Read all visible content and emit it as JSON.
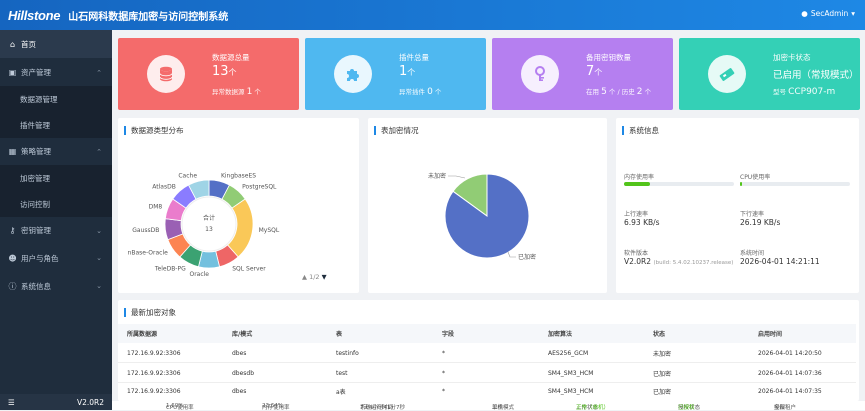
{
  "header": {
    "logo": "Hillstone",
    "title": "山石网科数据库加密与访问控制系统",
    "user": "SecAdmin",
    "user_icon": "user-icon",
    "color": "#1e88e5"
  },
  "sidebar": {
    "items": [
      {
        "label": "首页",
        "icon": "home-icon",
        "level": 0,
        "active": true
      },
      {
        "label": "资产管理",
        "icon": "asset-icon",
        "level": 0,
        "expanded": true
      },
      {
        "label": "数据源管理",
        "level": 1
      },
      {
        "label": "插件管理",
        "level": 1
      },
      {
        "label": "策略管理",
        "icon": "policy-icon",
        "level": 0,
        "expanded": true
      },
      {
        "label": "加密管理",
        "level": 1
      },
      {
        "label": "访问控制",
        "level": 1
      },
      {
        "label": "密钥管理",
        "icon": "key-icon",
        "level": 0
      },
      {
        "label": "用户与角色",
        "icon": "users-icon",
        "level": 0
      },
      {
        "label": "系统信息",
        "icon": "info-icon",
        "level": 0
      }
    ],
    "version": "V2.0R2"
  },
  "cards": [
    {
      "title": "数据源总量",
      "value": "13",
      "unit": "个",
      "sub_label": "异常数据源",
      "sub_value": "1",
      "sub_unit": "个",
      "color": "#f46b6b",
      "icon": "database-icon"
    },
    {
      "title": "插件总量",
      "value": "1",
      "unit": "个",
      "sub_label": "异常插件",
      "sub_value": "0",
      "sub_unit": "个",
      "color": "#4fb8f0",
      "icon": "puzzle-icon"
    },
    {
      "title": "备用密钥数量",
      "value": "7",
      "unit": "个",
      "sub_label": "在用",
      "sub_value": "5",
      "sub_unit": "个",
      "sub_label2": "历史",
      "sub_value2": "2",
      "sub_unit2": "个",
      "color": "#b57ff0",
      "icon": "key-lock-icon"
    },
    {
      "title": "加密卡状态",
      "value": "已启用（常规模式）",
      "sub_label": "型号",
      "sub_value": "CCP907-m",
      "color": "#34d0b6",
      "icon": "card-icon"
    }
  ],
  "datasource_dist": {
    "title": "数据源类型分布",
    "center_label": "合计",
    "center_value": "13",
    "page": "1/2",
    "labels_on_ring": [
      "KingbaseES",
      "PostgreSQL",
      "MySQL",
      "SQL Server",
      "Oracle",
      "TeleDB-PG",
      "nBase-Oracle",
      "GaussDB",
      "DM8",
      "AtlasDB",
      "Cache"
    ]
  },
  "encryption_status": {
    "title": "表加密情况",
    "labels": [
      "未加密",
      "已加密"
    ]
  },
  "sysinfo": {
    "title": "系统信息",
    "mem_label": "内存使用率",
    "mem_pct": 0.24,
    "cpu_label": "CPU使用率",
    "cpu_pct": 0.02,
    "up_label": "上行速率",
    "up_value": "6.93 KB/s",
    "down_label": "下行速率",
    "down_value": "26.19 KB/s",
    "sw_label": "软件版本",
    "sw_value": "V2.0R2",
    "sw_build": "(build: 5.4.02.10237.release)",
    "time_label": "系统时间",
    "time_value": "2026-04-01 14:21:11"
  },
  "recent": {
    "title": "最新加密对象",
    "columns": [
      "所属数据源",
      "库/模式",
      "表",
      "字段",
      "加密算法",
      "状态",
      "启用时间"
    ],
    "rows": [
      [
        "172.16.9.92:3306",
        "dbes",
        "testinfo",
        "*",
        "AES256_GCM",
        "未加密",
        "2026-04-01 14:20:50"
      ],
      [
        "172.16.9.92:3306",
        "dbesdb",
        "test",
        "*",
        "SM4_SM3_HCM",
        "已加密",
        "2026-04-01 14:07:36"
      ],
      [
        "172.16.9.92:3306",
        "dbes",
        "a表",
        "*",
        "SM4_SM3_HCM",
        "已加密",
        "2026-04-01 14:07:35"
      ]
    ]
  },
  "statusbar": {
    "cpu_label": "CPU使用率",
    "cpu_value": "1.60%",
    "mem_label": "内存使用率",
    "mem_value": "23.64%",
    "uptime_label": "系统运行时间",
    "uptime_value": "7天4小时41分7秒",
    "mode_label": "工作模式",
    "mode_value": "单机",
    "work_label": "工作状态",
    "work_value": "正常（单机）",
    "auth_label": "授权状态",
    "auth_value": "已授权",
    "tenant_label": "授权租户",
    "tenant_value": "全部"
  },
  "chart_data": [
    {
      "type": "pie",
      "title": "数据源类型分布",
      "categories": [
        "KingbaseES",
        "PostgreSQL",
        "MySQL",
        "SQL Server",
        "Oracle",
        "TeleDB-PG",
        "OceanBase-Oracle",
        "GaussDB",
        "DM8",
        "AtlasDB"
      ],
      "series": [
        {
          "values": [
            1,
            1,
            3,
            1,
            1,
            1,
            1,
            1,
            1,
            1
          ],
          "percent_labels": [
            "8%",
            "8%",
            "23%",
            "8%",
            "8%",
            "8%",
            "",
            "",
            "8%",
            "8%"
          ]
        }
      ],
      "colors": [
        "#5470c6",
        "#91cc75",
        "#fac858",
        "#ee6666",
        "#73c0de",
        "#3ba272",
        "#fc8452",
        "#9a60b4",
        "#ea7ccc",
        "#8a7cff",
        "#9fd4e6"
      ]
    },
    {
      "type": "pie",
      "title": "表加密情况",
      "categories": [
        "未加密",
        "已加密"
      ],
      "series": [
        {
          "values": [
            0.15,
            0.85
          ]
        }
      ],
      "colors": [
        "#91cc75",
        "#5470c6"
      ]
    }
  ]
}
